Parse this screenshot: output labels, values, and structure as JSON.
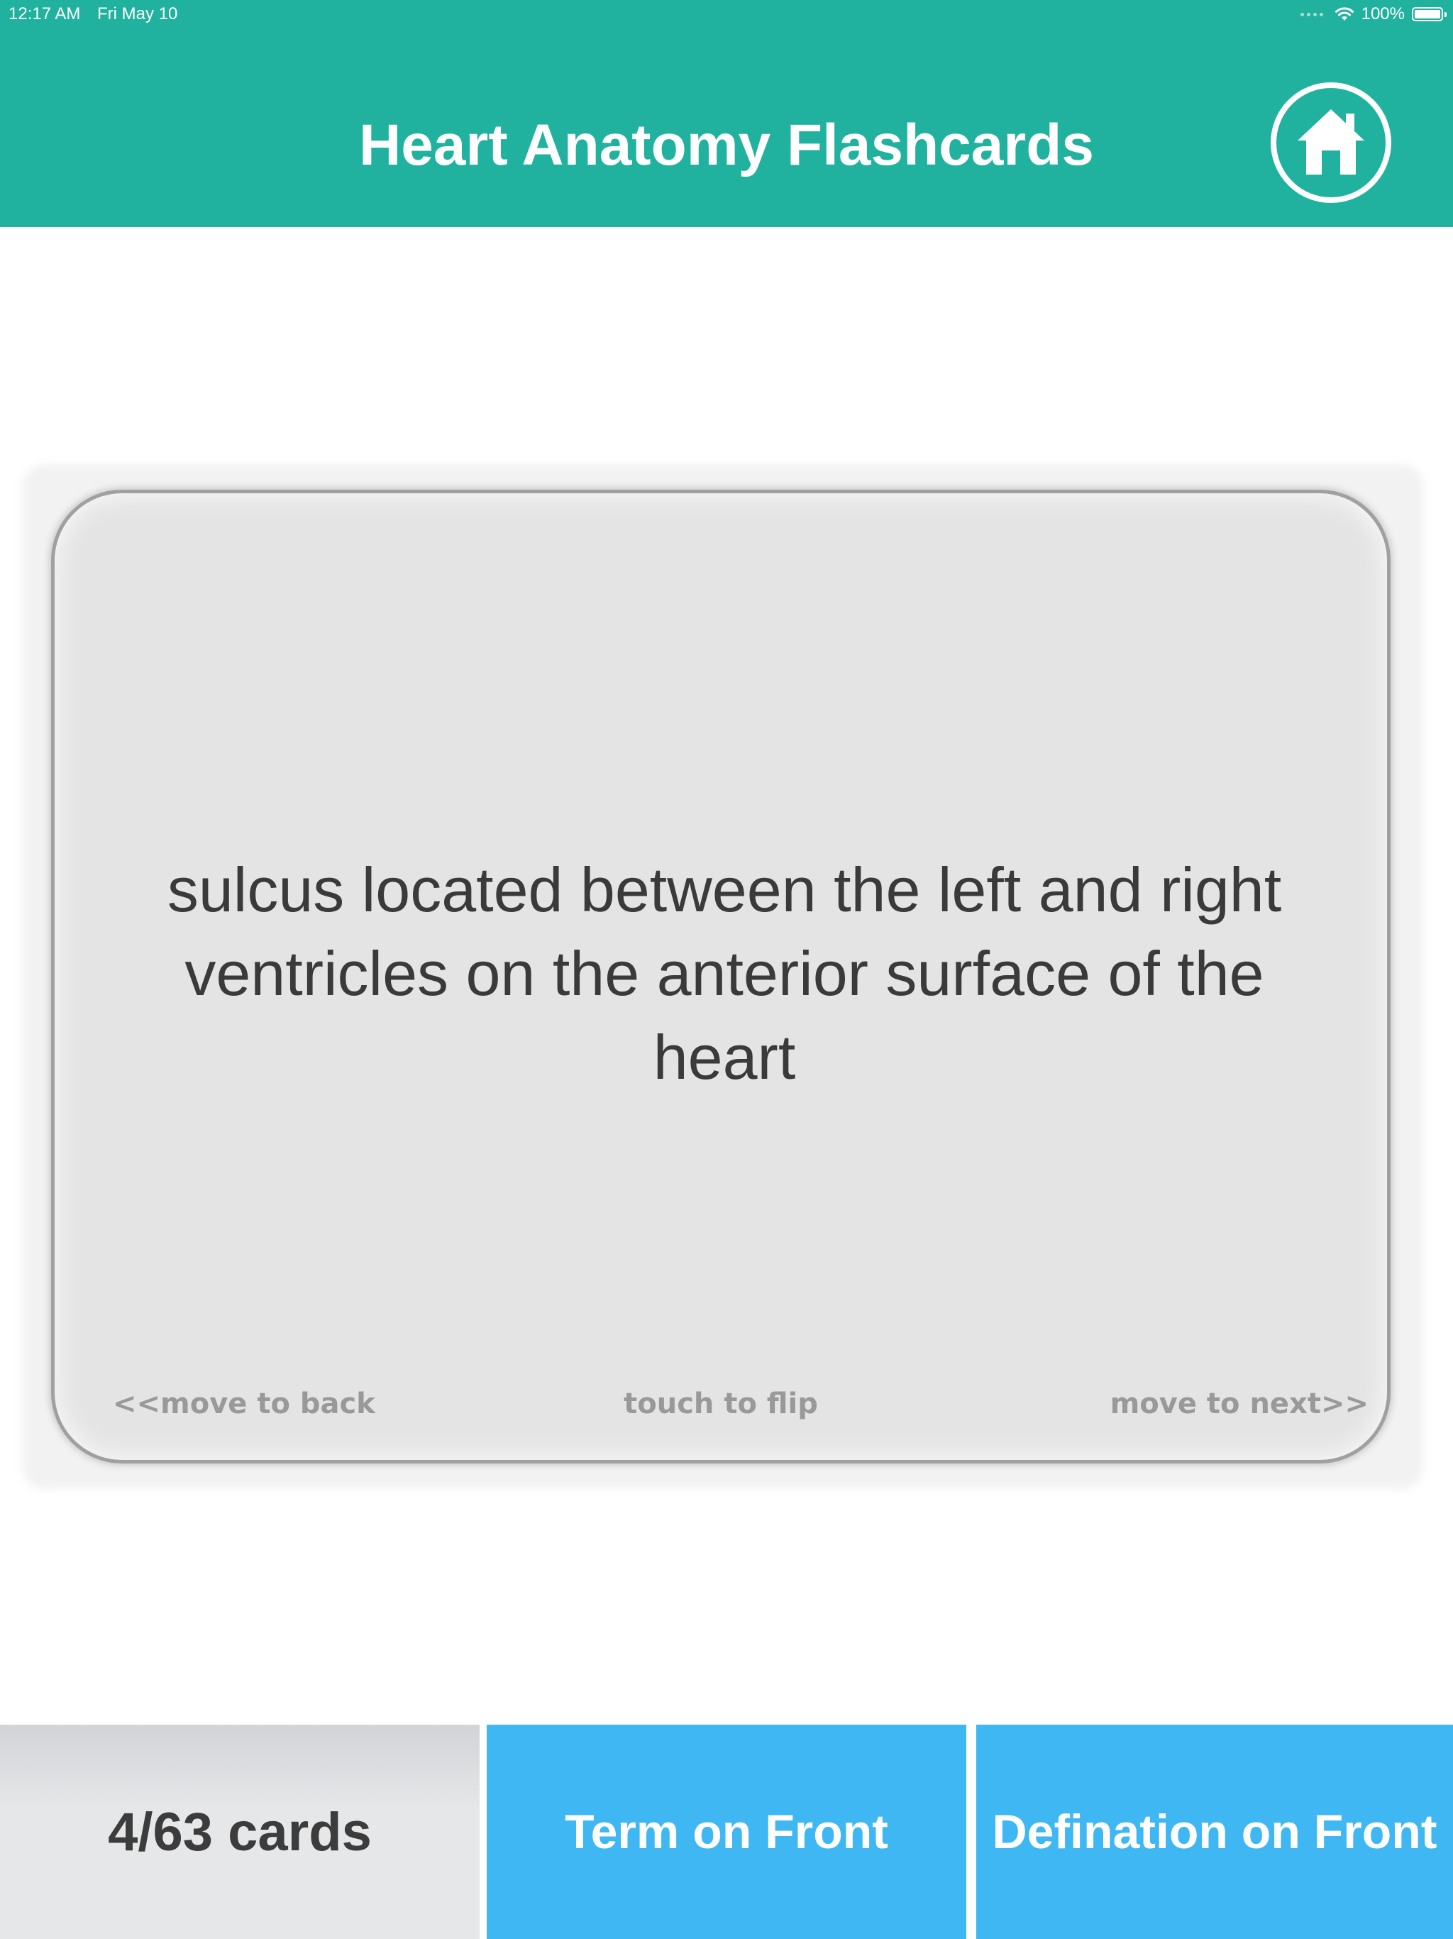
{
  "status_bar": {
    "time": "12:17 AM",
    "date": "Fri May 10",
    "battery": "100%",
    "battery_level": 1.0
  },
  "header": {
    "title": "Heart Anatomy Flashcards",
    "home_icon": "home-icon",
    "background_color": "#20b29e"
  },
  "card": {
    "text": "sulcus located between the left and right ventricles on the anterior surface of the heart",
    "hint_back": "<<move to back",
    "hint_flip": "touch to flip",
    "hint_next": "move to next>>"
  },
  "bottom": {
    "card_count": "4/63 cards",
    "term_on_front": "Term on Front",
    "definition_on_front": "Defination on Front",
    "button_color": "#3fb7f3"
  }
}
